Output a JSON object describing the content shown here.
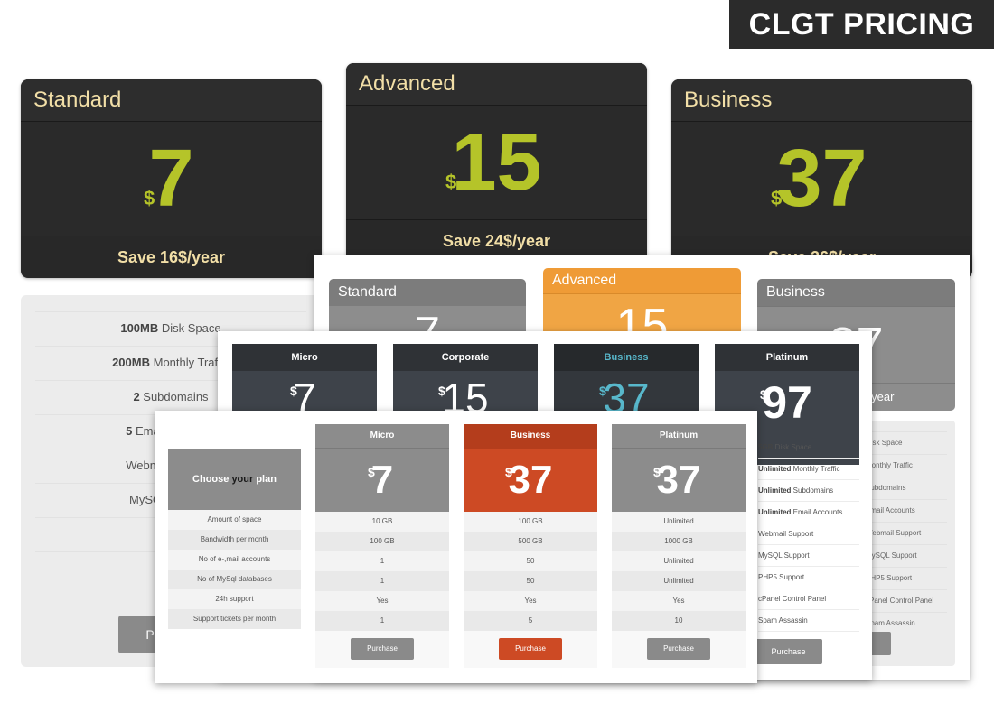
{
  "brand": {
    "title": "CLGT PRICING"
  },
  "layer1": {
    "cards": [
      {
        "name": "Standard",
        "currency": "$",
        "price": "7",
        "save": "Save 16$/year"
      },
      {
        "name": "Advanced",
        "currency": "$",
        "price": "15",
        "save": "Save 24$/year"
      },
      {
        "name": "Business",
        "currency": "$",
        "price": "37",
        "save": "Save 36$/year"
      }
    ],
    "features": [
      {
        "bold": "100MB",
        "text": " Disk Space"
      },
      {
        "bold": "200MB",
        "text": " Monthly Traffic"
      },
      {
        "bold": "2",
        "text": " Subdomains"
      },
      {
        "bold": "5",
        "text": " Email Accounts"
      },
      {
        "bold": "",
        "text": "Webmail Support"
      },
      {
        "bold": "",
        "text": "MySQL Support"
      }
    ],
    "purchase": "Purchase"
  },
  "layer2": {
    "cards": [
      {
        "name": "Standard",
        "currency": "$",
        "price": "7"
      },
      {
        "name": "Advanced",
        "currency": "$",
        "price": "15"
      },
      {
        "name": "Business",
        "currency": "$",
        "price": "37",
        "save": "Save 36$/year"
      }
    ],
    "right_rows": [
      "Disk Space",
      "Monthly Traffic",
      "Subdomains",
      "Email Accounts",
      "Webmail Support",
      "MySQL Support",
      "PHP5 Support",
      "cPanel Control Panel",
      "Spam Assassin"
    ]
  },
  "layer3": {
    "plans": [
      {
        "name": "Micro",
        "currency": "$",
        "price": "7"
      },
      {
        "name": "Corporate",
        "currency": "$",
        "price": "15"
      },
      {
        "name": "Business",
        "currency": "$",
        "price": "37"
      },
      {
        "name": "Platinum",
        "currency": "$",
        "price": "97"
      }
    ],
    "platinum_features": [
      {
        "bold": "5GB",
        "text": " Disk Space"
      },
      {
        "bold": "Unlimited",
        "text": " Monthly Traffic"
      },
      {
        "bold": "Unlimited",
        "text": " Subdomains"
      },
      {
        "bold": "Unlimited",
        "text": " Email Accounts"
      },
      {
        "bold": "",
        "text": "Webmail Support"
      },
      {
        "bold": "",
        "text": "MySQL Support"
      },
      {
        "bold": "",
        "text": "PHP5 Support"
      },
      {
        "bold": "",
        "text": "cPanel Control Panel"
      },
      {
        "bold": "",
        "text": "Spam Assassin"
      }
    ],
    "purchase": "Purchase"
  },
  "layer4": {
    "choose_pre": "Choose ",
    "choose_bold": "your",
    "choose_post": " plan",
    "row_labels": [
      "Amount of space",
      "Bandwidth per month",
      "No of e-,mail accounts",
      "No of MySql databases",
      "24h support",
      "Support tickets per month"
    ],
    "plans": [
      {
        "name": "Micro",
        "currency": "$",
        "price": "7",
        "values": [
          "10 GB",
          "100 GB",
          "1",
          "1",
          "Yes",
          "1"
        ],
        "button": "Purchase"
      },
      {
        "name": "Business",
        "currency": "$",
        "price": "37",
        "values": [
          "100 GB",
          "500 GB",
          "50",
          "50",
          "Yes",
          "5"
        ],
        "button": "Purchase"
      },
      {
        "name": "Platinum",
        "currency": "$",
        "price": "37",
        "values": [
          "Unlimited",
          "1000 GB",
          "Unlimited",
          "Unlimited",
          "Yes",
          "10"
        ],
        "button": "Purchase"
      }
    ]
  },
  "colors": {
    "price_green": "#b5c429",
    "advanced_orange": "#ef9b36",
    "business_red": "#cd4a24",
    "business_teal": "#58b8cc"
  }
}
